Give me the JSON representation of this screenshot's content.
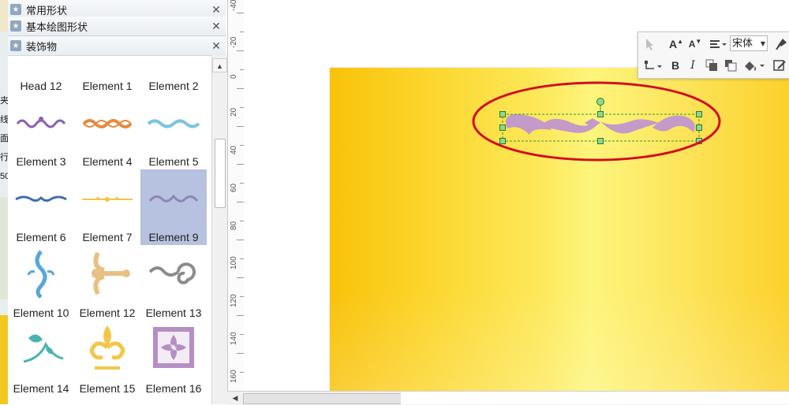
{
  "left_strip": {
    "fragments": [
      "夹",
      "线",
      "面",
      "行",
      "50"
    ]
  },
  "library": {
    "headers": [
      {
        "title": "常用形状",
        "close": "✕"
      },
      {
        "title": "基本绘图形状",
        "close": "✕"
      },
      {
        "title": "装饰物",
        "close": "✕"
      }
    ],
    "shapes": [
      {
        "label": "Head 12"
      },
      {
        "label": "Element 1"
      },
      {
        "label": "Element 2"
      },
      {
        "label": "Element 3"
      },
      {
        "label": "Element 4"
      },
      {
        "label": "Element 5"
      },
      {
        "label": "Element 6"
      },
      {
        "label": "Element 7"
      },
      {
        "label": "Element 9",
        "selected": true
      },
      {
        "label": "Element 10"
      },
      {
        "label": "Element 12"
      },
      {
        "label": "Element 13"
      },
      {
        "label": "Element 14"
      },
      {
        "label": "Element 15"
      },
      {
        "label": "Element 16"
      }
    ],
    "scroll_up": "▲"
  },
  "ruler": {
    "labels": [
      "-40",
      "-20",
      "0",
      "20",
      "40",
      "60",
      "80",
      "100",
      "120",
      "140",
      "160"
    ]
  },
  "toolbar": {
    "font_name": "宋体",
    "bold": "B",
    "italic": "I",
    "grow_font": "A",
    "shrink_font": "A"
  },
  "hscroll": {
    "left_arrow": "◀"
  },
  "colors": {
    "highlight_ellipse": "#d01020",
    "ornament": "#c49ac9",
    "selection_handle": "#8fd98f",
    "page_gradient_edge": "#f9c20a",
    "page_gradient_center": "#fdf57c"
  }
}
